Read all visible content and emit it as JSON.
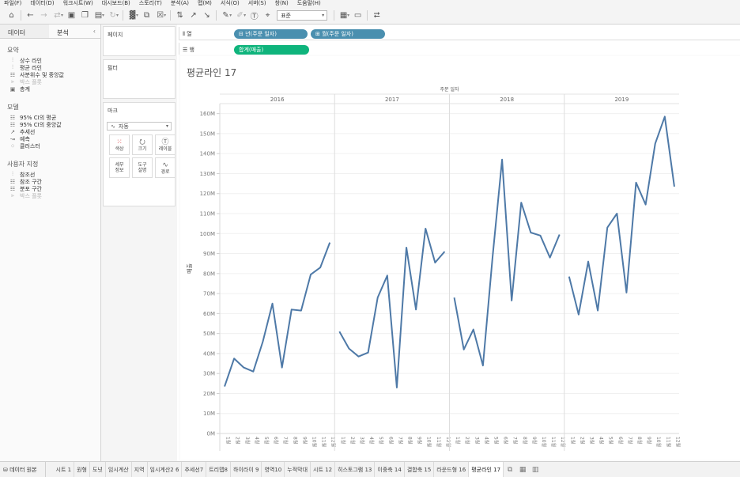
{
  "menubar": [
    "파일(F)",
    "데이터(D)",
    "워크시트(W)",
    "대시보드(B)",
    "스토리(T)",
    "분석(A)",
    "맵(M)",
    "서식(O)",
    "서버(S)",
    "창(N)",
    "도움말(H)"
  ],
  "toolbar": {
    "fit": "표준"
  },
  "left_pane": {
    "tabs": [
      "데이터",
      "분석"
    ],
    "sections": [
      {
        "title": "요약",
        "items": [
          {
            "label": "상수 라인",
            "icon": "constant-line-icon",
            "enabled": true
          },
          {
            "label": "평균 라인",
            "icon": "average-line-icon",
            "enabled": true
          },
          {
            "label": "사분위수 및 중앙값",
            "icon": "quartile-icon",
            "enabled": true
          },
          {
            "label": "박스 플롯",
            "icon": "box-plot-icon",
            "enabled": false
          },
          {
            "label": "총계",
            "icon": "totals-icon",
            "enabled": true
          }
        ]
      },
      {
        "title": "모델",
        "items": [
          {
            "label": "95% CI의 평균",
            "icon": "ci-mean-icon",
            "enabled": true
          },
          {
            "label": "95% CI의 중앙값",
            "icon": "ci-median-icon",
            "enabled": true
          },
          {
            "label": "추세선",
            "icon": "trend-line-icon",
            "enabled": true
          },
          {
            "label": "예측",
            "icon": "forecast-icon",
            "enabled": true
          },
          {
            "label": "클러스터",
            "icon": "cluster-icon",
            "enabled": true
          }
        ]
      },
      {
        "title": "사용자 지정",
        "items": [
          {
            "label": "참조선",
            "icon": "reference-line-icon",
            "enabled": true
          },
          {
            "label": "참조 구간",
            "icon": "reference-band-icon",
            "enabled": true
          },
          {
            "label": "분포 구간",
            "icon": "distribution-band-icon",
            "enabled": true
          },
          {
            "label": "박스 플롯",
            "icon": "box-plot-icon",
            "enabled": false
          }
        ]
      }
    ]
  },
  "cards": {
    "pages": "페이지",
    "filters": "필터",
    "marks": "마크",
    "mark_type": "자동",
    "buttons": [
      {
        "line1": "색상",
        "line2": "",
        "icon": "color-icon"
      },
      {
        "line1": "크기",
        "line2": "",
        "icon": "size-icon"
      },
      {
        "line1": "레이블",
        "line2": "",
        "icon": "label-icon"
      },
      {
        "line1": "세부",
        "line2": "정보",
        "icon": "detail-icon"
      },
      {
        "line1": "도구",
        "line2": "설명",
        "icon": "tooltip-icon"
      },
      {
        "line1": "경로",
        "line2": "",
        "icon": "path-icon"
      }
    ]
  },
  "shelves": {
    "columns_label": "열",
    "rows_label": "행",
    "columns": [
      "년(주문 일자)",
      "월(주문 일자)"
    ],
    "rows": [
      "합계(매출)"
    ]
  },
  "worksheet_title": "평균라인 17",
  "chart_data": {
    "type": "line",
    "title": "평균라인 17",
    "header": "주문 일자",
    "ylabel": "매출",
    "ylim": [
      0,
      165000000
    ],
    "yticks": [
      "0M",
      "10M",
      "20M",
      "30M",
      "40M",
      "50M",
      "60M",
      "70M",
      "80M",
      "90M",
      "100M",
      "110M",
      "120M",
      "130M",
      "140M",
      "150M",
      "160M"
    ],
    "months": [
      "1월",
      "2월",
      "3월",
      "4월",
      "5월",
      "6월",
      "7월",
      "8월",
      "9월",
      "10월",
      "11월",
      "12월"
    ],
    "panes": [
      {
        "year": "2016",
        "values": [
          23.5,
          37.5,
          33,
          31,
          46,
          65,
          33,
          62,
          61.5,
          79.5,
          83,
          95.5
        ]
      },
      {
        "year": "2017",
        "values": [
          51,
          42.5,
          38.5,
          40.5,
          68,
          79,
          23,
          93,
          62,
          102.5,
          85.5,
          91
        ]
      },
      {
        "year": "2018",
        "values": [
          68,
          42,
          52,
          34,
          88,
          137,
          66.5,
          115.5,
          100.5,
          99,
          88,
          99.5
        ]
      },
      {
        "year": "2019",
        "values": [
          78.5,
          59.5,
          86,
          61.5,
          103,
          110,
          70.5,
          125.5,
          114.5,
          145,
          158.5,
          123.5
        ]
      }
    ],
    "value_unit": "M",
    "line_color": "#4e79a7",
    "grid": true
  },
  "sheet_tabs": {
    "datasource": "데이터 원본",
    "tabs": [
      "시트 1",
      "원형",
      "도넛",
      "임시계산",
      "지역",
      "임시계산2 6",
      "추세선7",
      "트리맵8",
      "하이라이 9",
      "영역10",
      "누적막대",
      "시트 12",
      "히스토그램 13",
      "이중축 14",
      "결합축 15",
      "라운드형 16",
      "평균라인 17"
    ],
    "active": "평균라인 17"
  }
}
